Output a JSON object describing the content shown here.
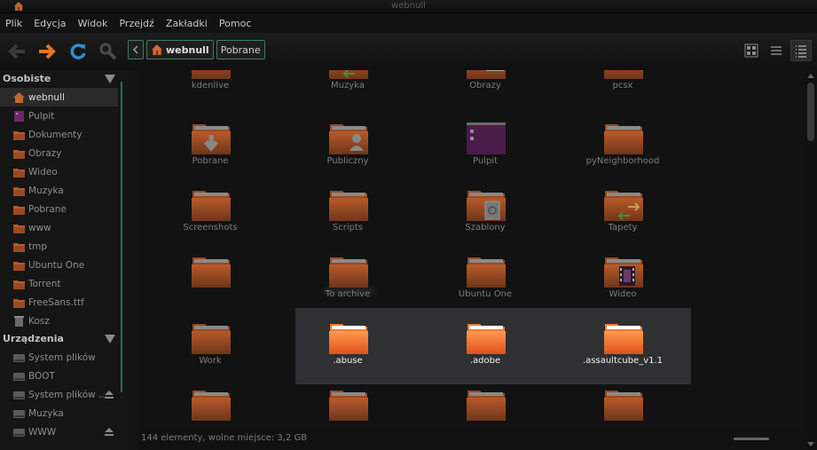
{
  "window": {
    "title": "webnull"
  },
  "menu": [
    "Plik",
    "Edycja",
    "Widok",
    "Przejdź",
    "Zakładki",
    "Pomoc"
  ],
  "breadcrumbs": {
    "home": "webnull",
    "current": "Pobrane"
  },
  "sidebar": {
    "personal_header": "Osobiste",
    "personal": [
      {
        "label": "webnull",
        "icon": "home-icon"
      },
      {
        "label": "Pulpit",
        "icon": "desktop-icon"
      },
      {
        "label": "Dokumenty",
        "icon": "documents-folder-icon"
      },
      {
        "label": "Obrazy",
        "icon": "pictures-folder-icon"
      },
      {
        "label": "Wideo",
        "icon": "videos-folder-icon"
      },
      {
        "label": "Muzyka",
        "icon": "music-folder-icon"
      },
      {
        "label": "Pobrane",
        "icon": "downloads-folder-icon"
      },
      {
        "label": "www",
        "icon": "folder-icon"
      },
      {
        "label": "tmp",
        "icon": "folder-icon"
      },
      {
        "label": "Ubuntu One",
        "icon": "folder-icon"
      },
      {
        "label": "Torrent",
        "icon": "folder-icon"
      },
      {
        "label": "FreeSans.ttf",
        "icon": "folder-icon"
      },
      {
        "label": "Kosz",
        "icon": "trash-icon"
      }
    ],
    "devices_header": "Urządzenia",
    "devices": [
      {
        "label": "System plików",
        "icon": "drive-icon"
      },
      {
        "label": "BOOT",
        "icon": "drive-icon"
      },
      {
        "label": "System plików ...",
        "icon": "drive-icon"
      },
      {
        "label": "Muzyka",
        "icon": "drive-icon"
      },
      {
        "label": "WWW",
        "icon": "drive-icon"
      }
    ]
  },
  "items": [
    {
      "label": "kdenlive",
      "kind": "folder"
    },
    {
      "label": "Muzyka",
      "kind": "music"
    },
    {
      "label": "Obrazy",
      "kind": "pictures"
    },
    {
      "label": "pcsx",
      "kind": "folder"
    },
    {
      "label": "Pobrane",
      "kind": "downloads"
    },
    {
      "label": "Publiczny",
      "kind": "public"
    },
    {
      "label": "Pulpit",
      "kind": "desktop"
    },
    {
      "label": "pyNeighborhood",
      "kind": "folder"
    },
    {
      "label": "Screenshots",
      "kind": "folder"
    },
    {
      "label": "Scripts",
      "kind": "folder"
    },
    {
      "label": "Szablony",
      "kind": "templates"
    },
    {
      "label": "Tapety",
      "kind": "music"
    },
    {
      "label": "",
      "kind": "folder"
    },
    {
      "label": "To archive",
      "kind": "folder"
    },
    {
      "label": "Ubuntu One",
      "kind": "folder"
    },
    {
      "label": "Wideo",
      "kind": "videos"
    },
    {
      "label": "Work",
      "kind": "folder"
    },
    {
      "label": ".abuse",
      "kind": "folder",
      "selected": true
    },
    {
      "label": ".adobe",
      "kind": "folder",
      "selected": true
    },
    {
      "label": ".assaultcube_v1.1",
      "kind": "folder",
      "selected": true
    },
    {
      "label": "",
      "kind": "folder"
    },
    {
      "label": "",
      "kind": "folder"
    },
    {
      "label": "",
      "kind": "folder"
    },
    {
      "label": "",
      "kind": "folder"
    }
  ],
  "status": "144 elementy, wolne miejsce: 3,2 GB",
  "colors": {
    "folder": "#d9692c",
    "folder_dark": "#8c4a24",
    "accent": "#2e7050"
  }
}
